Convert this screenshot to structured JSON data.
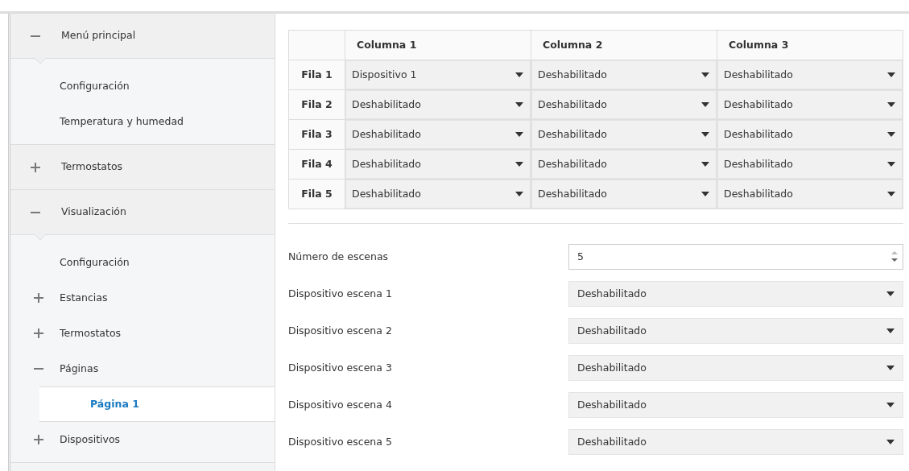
{
  "sidebar": {
    "groups": [
      {
        "label": "Menú principal",
        "expanded": true,
        "children": [
          {
            "kind": "leaf",
            "label": "Configuración",
            "selected": false
          },
          {
            "kind": "leaf",
            "label": "Temperatura y humedad",
            "selected": false
          }
        ]
      },
      {
        "label": "Termostatos",
        "expanded": false
      },
      {
        "label": "Visualización",
        "expanded": true,
        "children": [
          {
            "kind": "leaf",
            "label": "Configuración",
            "selected": false
          },
          {
            "kind": "folder",
            "label": "Estancias",
            "expanded": false
          },
          {
            "kind": "folder",
            "label": "Termostatos",
            "expanded": false
          },
          {
            "kind": "folder",
            "label": "Páginas",
            "expanded": true,
            "children": [
              {
                "kind": "leaf",
                "label": "Página 1",
                "selected": true
              }
            ]
          },
          {
            "kind": "folder",
            "label": "Dispositivos",
            "expanded": false
          }
        ]
      }
    ]
  },
  "grid": {
    "columns": [
      "Columna 1",
      "Columna 2",
      "Columna 3"
    ],
    "rows": [
      {
        "label": "Fila 1",
        "cells": [
          "Dispositivo 1",
          "Deshabilitado",
          "Deshabilitado"
        ]
      },
      {
        "label": "Fila 2",
        "cells": [
          "Deshabilitado",
          "Deshabilitado",
          "Deshabilitado"
        ]
      },
      {
        "label": "Fila 3",
        "cells": [
          "Deshabilitado",
          "Deshabilitado",
          "Deshabilitado"
        ]
      },
      {
        "label": "Fila 4",
        "cells": [
          "Deshabilitado",
          "Deshabilitado",
          "Deshabilitado"
        ]
      },
      {
        "label": "Fila 5",
        "cells": [
          "Deshabilitado",
          "Deshabilitado",
          "Deshabilitado"
        ]
      }
    ]
  },
  "form": [
    {
      "kind": "number",
      "label": "Número de escenas",
      "value": "5"
    },
    {
      "kind": "select",
      "label": "Dispositivo escena 1",
      "value": "Deshabilitado"
    },
    {
      "kind": "select",
      "label": "Dispositivo escena 2",
      "value": "Deshabilitado"
    },
    {
      "kind": "select",
      "label": "Dispositivo escena 3",
      "value": "Deshabilitado"
    },
    {
      "kind": "select",
      "label": "Dispositivo escena 4",
      "value": "Deshabilitado"
    },
    {
      "kind": "select",
      "label": "Dispositivo escena 5",
      "value": "Deshabilitado"
    }
  ]
}
